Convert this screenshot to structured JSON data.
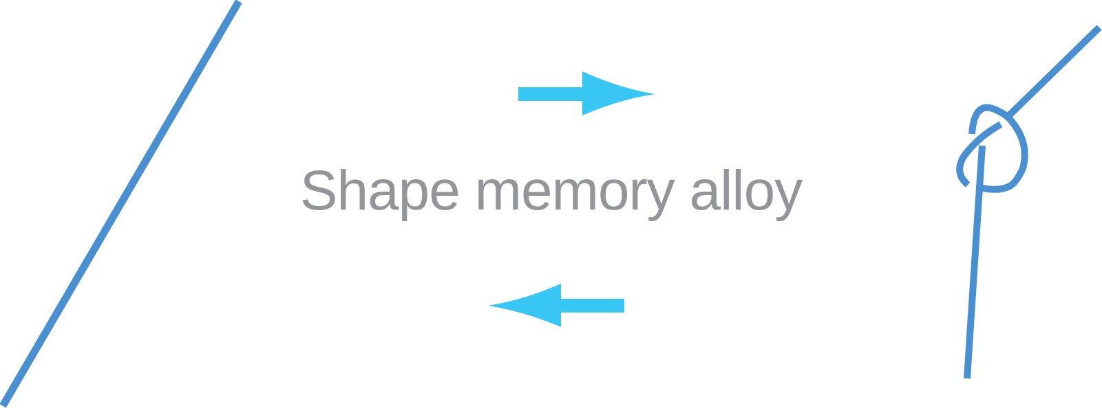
{
  "diagram": {
    "label": "Shape memory alloy",
    "colors": {
      "wire": "#4a8fcf",
      "arrow": "#38c6f4",
      "text": "#939598",
      "background": "#ffffff"
    },
    "elements": {
      "left_wire": "straight-wire",
      "right_wire": "knotted-wire",
      "top_arrow": "arrow-right",
      "bottom_arrow": "arrow-left"
    }
  }
}
